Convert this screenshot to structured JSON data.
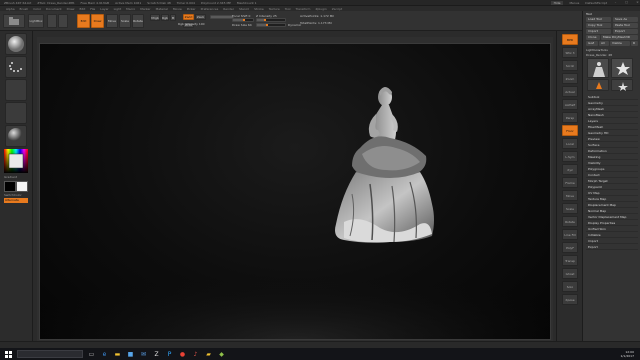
{
  "window": {
    "title_segments": [
      "ZBrush 4R7 64-bit",
      "ZTool: Dress_Render.ZPR",
      "Free Mem 4.913GB",
      "Active Mem 1061",
      "Scratch Disk 48",
      "Timer 0.004",
      "PolyCount 2.345 MP",
      "MeshCount 1"
    ],
    "hide_label": "Hide",
    "menu_button": "Menus",
    "default_script": "DefaultZScript"
  },
  "menus": [
    "Alpha",
    "Brush",
    "Color",
    "Document",
    "Draw",
    "Edit",
    "File",
    "Layer",
    "Light",
    "Macro",
    "Marker",
    "Material",
    "Movie",
    "Picker",
    "Preferences",
    "Render",
    "Stencil",
    "Stroke",
    "Texture",
    "Tool",
    "Transform",
    "Zplugin",
    "Zscript"
  ],
  "top_shelf": {
    "home_label": "LightBox",
    "buttons": [
      "Edit",
      "Draw",
      "Move",
      "Scale",
      "Rotate"
    ],
    "mrgb": "Mrgb",
    "rgb": "Rgb",
    "m": "M",
    "zadd": "Zadd",
    "zsub": "Zsub",
    "zcut": "Zcut",
    "rgb_intensity_label": "Rgb Intensity 100",
    "z_intensity_label": "Z Intensity 25",
    "focal_shift_label": "Focal Shift 0",
    "draw_size_label": "Draw Size 64",
    "dynamic_label": "Dynamic",
    "active_points_label": "ActivePoints: 1.172 Mil",
    "total_points_label": "TotalPoints: 1.173 Mil"
  },
  "tray": {
    "header": "Tool",
    "load_tool": "Load Tool",
    "save_as": "Save As",
    "copy_tool": "Copy Tool",
    "paste_tool": "Paste Tool",
    "import": "Import",
    "export": "Export",
    "clone": "Clone",
    "make_polymesh": "Make PolyMesh3D",
    "goz": "GoZ",
    "all": "All",
    "visible": "Visible",
    "r": "R",
    "lightbox_tools": "Lightbox▸Tools",
    "current_tool": "Dress_Render. 48",
    "menu_items": [
      "Subtool",
      "Geometry",
      "ArrayMesh",
      "NanoMesh",
      "Layers",
      "FiberMesh",
      "Geometry HD",
      "Preview",
      "Surface",
      "Deformation",
      "Masking",
      "Visibility",
      "Polygroups",
      "Contact",
      "Morph Target",
      "Polypaint",
      "UV Map",
      "Texture Map",
      "Displacement Map",
      "Normal Map",
      "Vector Displacement Map",
      "Display Properties",
      "Unified Skin",
      "Initialize",
      "Import",
      "Export"
    ]
  },
  "left_shelf": {
    "tools": [
      "Standard",
      "DragRect",
      "Alpha Off",
      "Texture Off",
      "MatCap Gray"
    ],
    "gradient_label": "Gradient",
    "switch_color_label": "SwitchColor",
    "alternate_label": "Alternate"
  },
  "right_shelf": {
    "buttons": [
      "BPR",
      "SPix 3",
      "Scroll",
      "Zoom",
      "Actual",
      "AAHalf",
      "Persp",
      "Floor",
      "Local",
      "L.Sym",
      "Xyz",
      "Frame",
      "Move",
      "Scale",
      "Rotate",
      "Line Fill",
      "PolyF",
      "Transp",
      "Ghost",
      "Solo",
      "Xpose"
    ]
  },
  "colors": {
    "accent": "#e87a1e",
    "panel": "#323232",
    "canvas": "#0d0d0d"
  },
  "taskbar": {
    "icons": [
      "windows-icon",
      "search-icon",
      "task-view-icon",
      "edge-icon",
      "explorer-icon",
      "store-icon",
      "mail-icon",
      "zbrush-icon",
      "photoshop-icon",
      "chrome-icon",
      "music-icon",
      "folder-icon",
      "app-icon"
    ],
    "time": "12:00",
    "date": "1/1/2017"
  }
}
